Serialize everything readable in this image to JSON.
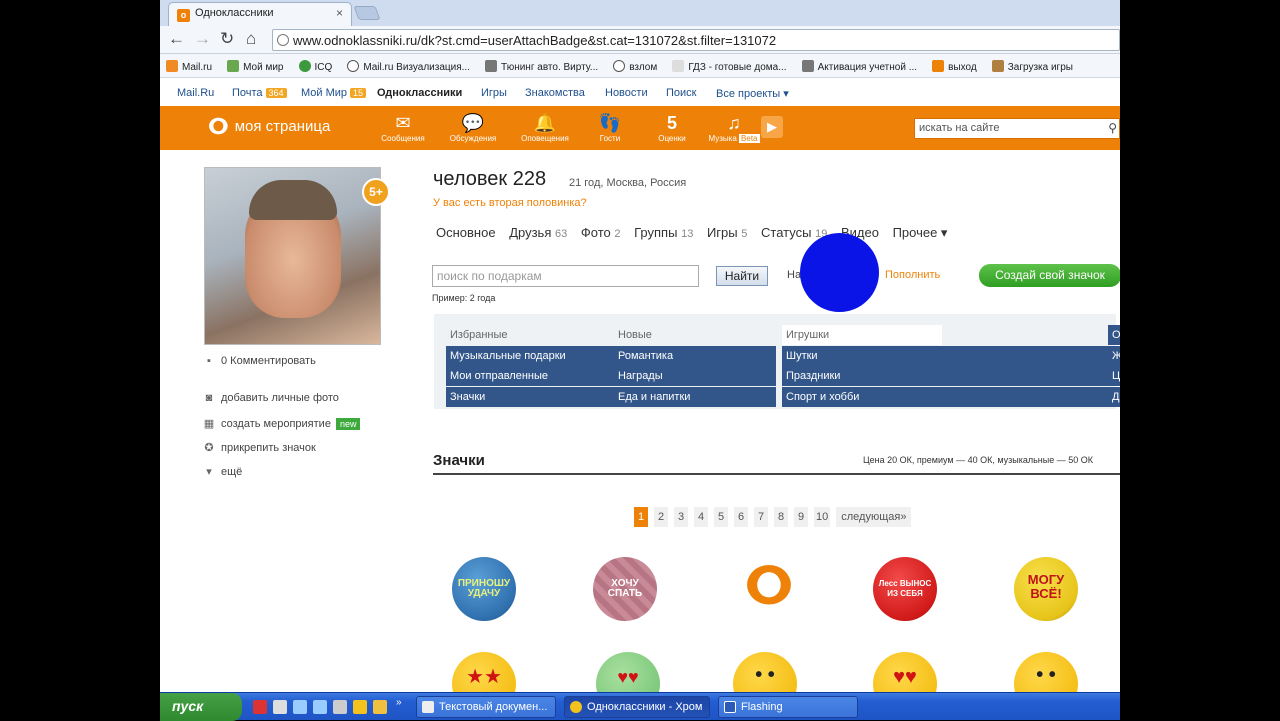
{
  "browser": {
    "tab_title": "Одноклассники",
    "tab_favicon": "ok",
    "url": "www.odnoklassniki.ru/dk?st.cmd=userAttachBadge&st.cat=131072&st.filter=131072",
    "nav_icons": {
      "back": "←",
      "forward": "→",
      "reload": "↻",
      "home": "⌂"
    },
    "bookmarks": [
      "Mail.ru",
      "Мой мир",
      "ICQ",
      "Mail.ru Визуализация...",
      "Тюнинг авто. Вирту...",
      "взлом",
      "ГДЗ - готовые дома...",
      "Активация учетной ...",
      "выход",
      "Загрузка игры"
    ]
  },
  "portal": {
    "links": [
      "Mail.Ru",
      "Почта",
      "Мой Мир",
      "Одноклассники",
      "Игры",
      "Знакомства",
      "Новости",
      "Поиск",
      "Все проекты ▾"
    ],
    "mail_count": "364",
    "myworld_count": "15"
  },
  "header": {
    "logo_glyph": "ok",
    "logo_text": "моя страница",
    "nav": [
      {
        "label": "Сообщения",
        "icon": "✉"
      },
      {
        "label": "Обсуждения",
        "icon": "💬"
      },
      {
        "label": "Оповещения",
        "icon": "🔔"
      },
      {
        "label": "Гости",
        "icon": "👣"
      },
      {
        "label": "Оценки",
        "icon": "5"
      },
      {
        "label": "Музыка",
        "icon": "♫"
      }
    ],
    "music_beta": "Beta",
    "search_placeholder": "искать на сайте"
  },
  "sidebar": {
    "age_badge": "5+",
    "comments": "0 Комментировать",
    "actions": [
      "добавить личные фото",
      "создать мероприятие",
      "прикрепить значок",
      "ещё"
    ],
    "new_tag": "new"
  },
  "profile": {
    "name": "человек 228",
    "meta": "21 год, Москва, Россия",
    "second_half": "У вас есть вторая половинка?",
    "tabs": [
      {
        "label": "Основное",
        "count": ""
      },
      {
        "label": "Друзья",
        "count": "63"
      },
      {
        "label": "Фото",
        "count": "2"
      },
      {
        "label": "Группы",
        "count": "13"
      },
      {
        "label": "Игры",
        "count": "5"
      },
      {
        "label": "Статусы",
        "count": "19"
      },
      {
        "label": "Видео",
        "count": ""
      },
      {
        "label": "Прочее ▾",
        "count": ""
      }
    ]
  },
  "gifts": {
    "search_placeholder": "поиск по подаркам",
    "find": "Найти",
    "example": "Пример: 2 года",
    "balance": "На счете 0 ОК",
    "topup": "Пополнить",
    "create": "Создай свой значок"
  },
  "categories": [
    [
      "Избранные",
      "Новые",
      "Игрушки",
      "Одежда и украшения"
    ],
    [
      "Музыкальные подарки",
      "Романтика",
      "Шутки",
      "Животные"
    ],
    [
      "Мои отправленные",
      "Награды",
      "Праздники",
      "Цветы"
    ],
    [
      "Значки",
      "Еда и напитки",
      "Спорт и хобби",
      "Другое"
    ]
  ],
  "section": {
    "title": "Значки",
    "price": "Цена 20 ОК, премиум — 40 ОК, музыкальные — 50 ОК"
  },
  "pager": {
    "pages": [
      "1",
      "2",
      "3",
      "4",
      "5",
      "6",
      "7",
      "8",
      "9",
      "10"
    ],
    "current": "1",
    "next": "следующая»"
  },
  "badges_row1": [
    {
      "text": "ПРИНОШУ УДАЧУ",
      "color": "#2f6fae"
    },
    {
      "text": "ХОЧУ СПАТЬ",
      "color": "#c98a97"
    },
    {
      "text": "",
      "color": "#ee8208"
    },
    {
      "text": "Лесс ВЫНОС ИЗ СЕБЯ",
      "color": "#d21a1a"
    },
    {
      "text": "МОГУ ВСЁ!",
      "color": "#e7c41a"
    }
  ],
  "taskbar": {
    "start": "пуск",
    "tasks": [
      "Текстовый докумен...",
      "Одноклассники - Хром",
      "Flashing"
    ]
  }
}
